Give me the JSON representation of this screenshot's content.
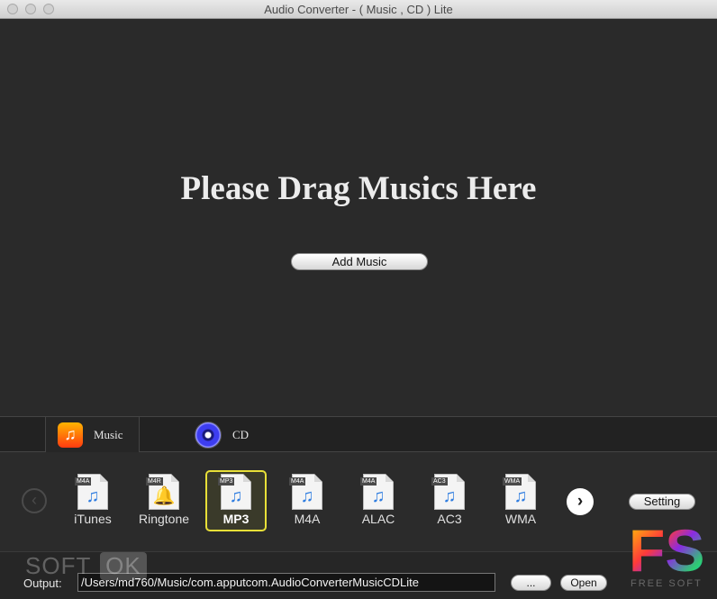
{
  "window": {
    "title": "Audio Converter - ( Music , CD ) Lite"
  },
  "dropzone": {
    "heading": "Please Drag Musics Here",
    "add_button": "Add Music"
  },
  "tabs": [
    {
      "label": "Music",
      "icon": "music-note-icon"
    },
    {
      "label": "CD",
      "icon": "cd-disc-icon"
    }
  ],
  "formats": [
    {
      "tag": "M4A",
      "label": "iTunes",
      "icon": "music-note-icon"
    },
    {
      "tag": "M4R",
      "label": "Ringtone",
      "icon": "bell-icon"
    },
    {
      "tag": "MP3",
      "label": "MP3",
      "icon": "music-note-icon",
      "selected": true
    },
    {
      "tag": "M4A",
      "label": "M4A",
      "icon": "music-note-icon"
    },
    {
      "tag": "M4A",
      "label": "ALAC",
      "icon": "music-note-icon"
    },
    {
      "tag": "AC3",
      "label": "AC3",
      "icon": "music-note-icon"
    },
    {
      "tag": "WMA",
      "label": "WMA",
      "icon": "music-note-icon"
    }
  ],
  "nav": {
    "prev_icon": "chevron-left-icon",
    "next_icon": "chevron-right-icon",
    "prev": "‹",
    "next": "›"
  },
  "setting_button": "Setting",
  "output": {
    "label": "Output:",
    "path": "/Users/md760/Music/com.apputcom.AudioConverterMusicCDLite",
    "browse_button": "...",
    "open_button": "Open"
  },
  "watermarks": {
    "softok_soft": "SOFT",
    "softok_ok": "OK",
    "fs_letters": "FS",
    "fs_sub": "FREE SOFT"
  },
  "colors": {
    "selected_border": "#e8e038",
    "note_blue": "#2f7de0"
  }
}
